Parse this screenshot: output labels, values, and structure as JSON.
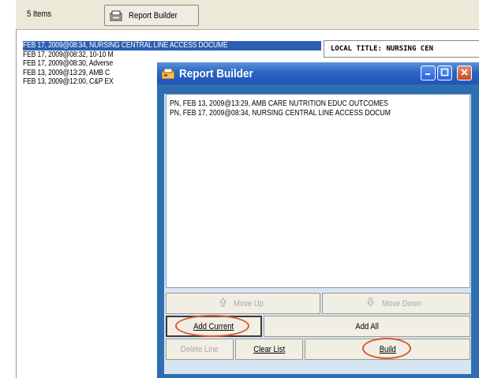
{
  "toolbar": {
    "items_count": "5 Items",
    "report_builder_button": "Report Builder"
  },
  "notes_list": [
    "FEB 17, 2009@08:34, NURSING CENTRAL LINE ACCESS DOCUME",
    "FEB 17, 2009@08:32, 10-10 M",
    "FEB 17, 2009@08:30, Adverse",
    "FEB 13, 2009@13:29, AMB C",
    "FEB 13, 2009@12:00, C&P EX"
  ],
  "detail_header": "LOCAL TITLE: NURSING CEN",
  "dialog": {
    "title": "Report Builder",
    "items": [
      "PN, FEB 13, 2009@13:29, AMB CARE NUTRITION EDUC OUTCOMES",
      "PN, FEB 17, 2009@08:34, NURSING CENTRAL LINE ACCESS DOCUM"
    ],
    "move_up": "Move Up",
    "move_down": "Move Down",
    "add_current": "Add Current",
    "add_all": "Add All",
    "delete_line": "Delete Line",
    "clear_list": "Clear List",
    "build": "Build"
  },
  "colors": {
    "selection": "#2b5fb0",
    "dialog_frame": "#2f6fb1",
    "highlight_circle": "#d9572e"
  },
  "icons": [
    "report-builder-icon",
    "app-icon",
    "minimize-icon",
    "maximize-icon",
    "close-icon",
    "arrow-up-icon",
    "arrow-down-icon"
  ]
}
